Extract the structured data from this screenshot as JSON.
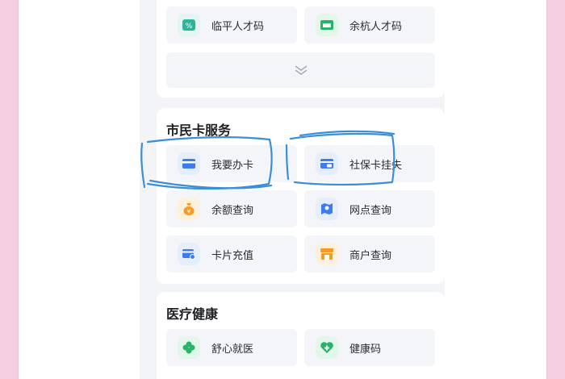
{
  "talent_codes": [
    {
      "label": "临平人才码",
      "icon": "talent-code-icon",
      "color": "#2fb39c"
    },
    {
      "label": "余杭人才码",
      "icon": "talent-card-icon",
      "color": "#27b36a"
    }
  ],
  "expand": {
    "icon": "chevron-double-down-icon"
  },
  "citizen_card": {
    "title": "市民卡服务",
    "items": [
      {
        "label": "我要办卡",
        "icon": "card-icon",
        "color": "#3b7cf5"
      },
      {
        "label": "社保卡挂失",
        "icon": "card-lock-icon",
        "color": "#3b7cf5"
      },
      {
        "label": "余额查询",
        "icon": "money-bag-icon",
        "color": "#f59a23"
      },
      {
        "label": "网点查询",
        "icon": "map-pin-icon",
        "color": "#3b7cf5"
      },
      {
        "label": "卡片充值",
        "icon": "card-topup-icon",
        "color": "#3b7cf5"
      },
      {
        "label": "商户查询",
        "icon": "store-icon",
        "color": "#f59a23"
      }
    ]
  },
  "medical": {
    "title": "医疗健康",
    "items": [
      {
        "label": "舒心就医",
        "icon": "clover-icon",
        "color": "#27b36a"
      },
      {
        "label": "健康码",
        "icon": "heart-plus-icon",
        "color": "#27b36a"
      }
    ]
  },
  "annotation": {
    "stroke": "#3a8fd8"
  }
}
